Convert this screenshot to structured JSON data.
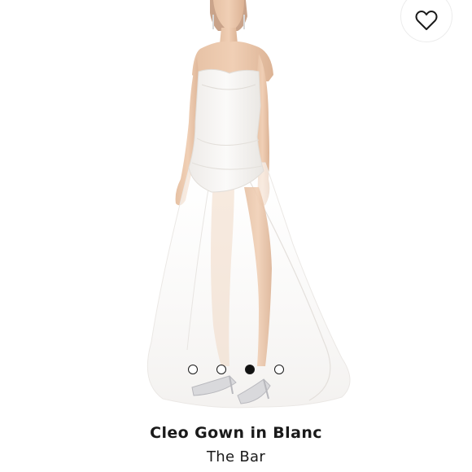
{
  "product": {
    "name": "Cleo Gown in Blanc",
    "brand": "The Bar"
  },
  "wishlist": {
    "icon": "heart-outline-icon"
  },
  "carousel": {
    "total": 4,
    "active_index": 3
  },
  "colors": {
    "background": "#ffffff",
    "text": "#1a1a1a",
    "gown": "#f6f4f2"
  }
}
